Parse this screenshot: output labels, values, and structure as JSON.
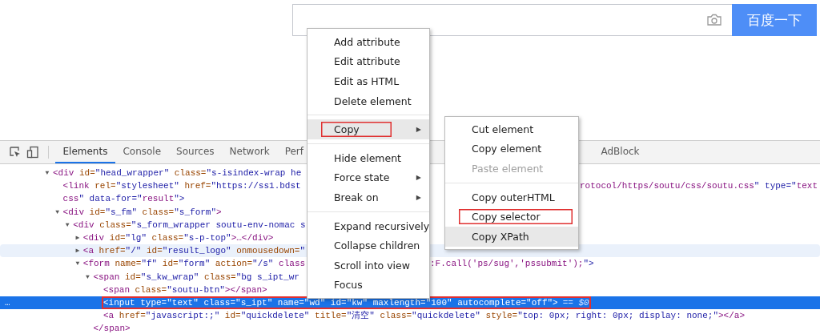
{
  "search": {
    "button": "百度一下"
  },
  "toolbar": {
    "tabs": [
      {
        "label": "Elements",
        "selected": true
      },
      {
        "label": "Console",
        "selected": false
      },
      {
        "label": "Sources",
        "selected": false
      },
      {
        "label": "Network",
        "selected": false
      },
      {
        "label": "Perf",
        "selected": false
      }
    ],
    "tabs_right": [
      {
        "label": "AdBlock",
        "selected": false
      }
    ]
  },
  "dom_tree": [
    {
      "toggle": "▼",
      "text": "<div id=\"head_wrapper\" class=\"s-isindex-wrap he",
      "selected": false,
      "hovered": false,
      "annotated": false,
      "children": [
        {
          "text": "<link rel=\"stylesheet\" href=\"https://ss1.bdst",
          "right_segment": {
            "kind": "beside_submenu",
            "text": "rotocol/https/soutu/css/soutu.css\" type=\"text"
          },
          "wrap_text": "css\" data-for=\"result\">",
          "selected": false,
          "hovered": false,
          "annotated": false
        },
        {
          "toggle": "▼",
          "text": "<div id=\"s_fm\" class=\"s_form\">",
          "selected": false,
          "hovered": false,
          "annotated": false,
          "children": [
            {
              "toggle": "▼",
              "text": "<div class=\"s_form_wrapper soutu-env-nomac s",
              "selected": false,
              "hovered": false,
              "annotated": false,
              "children": [
                {
                  "toggle": "▶",
                  "text": "<div id=\"lg\" class=\"s-p-top\">…</div>",
                  "selected": false,
                  "hovered": false,
                  "annotated": false
                },
                {
                  "toggle": "▶",
                  "text": "<a href=\"/\" id=\"result_logo\" onmousedown=\"",
                  "selected": false,
                  "hovered": true,
                  "annotated": false
                },
                {
                  "toggle": "▼",
                  "text": "<form name=\"f\" id=\"form\" action=\"/s\" class",
                  "right_segment": {
                    "kind": "beside_menu",
                    "text": ":F.call('ps/sug','pssubmit');\">"
                  },
                  "selected": false,
                  "hovered": false,
                  "annotated": false,
                  "children": [
                    {
                      "toggle": "▼",
                      "text": "<span id=\"s_kw_wrap\" class=\"bg s_ipt_wr",
                      "selected": false,
                      "hovered": false,
                      "annotated": false,
                      "closing": "</span>",
                      "children": [
                        {
                          "text": "<span class=\"soutu-btn\"></span>",
                          "selected": false,
                          "hovered": false,
                          "annotated": false
                        },
                        {
                          "gutter": "…",
                          "text": "<input type=\"text\" class=\"s_ipt\" name=\"wd\" id=\"kw\" maxlength=\"100\" autocomplete=\"off\">",
                          "suffix": "== $0",
                          "selected": true,
                          "hovered": false,
                          "annotated": true
                        },
                        {
                          "text": "<a href=\"javascript:;\" id=\"quickdelete\" title=\"清空\" class=\"quickdelete\" style=\"top: 0px; right: 0px; display: none;\"></a>",
                          "selected": false,
                          "hovered": false,
                          "annotated": false
                        }
                      ]
                    }
                  ]
                }
              ]
            }
          ]
        }
      ]
    }
  ],
  "context_menu": {
    "items": [
      {
        "kind": "item",
        "label": "Add attribute",
        "highlighted": false,
        "annotated": false
      },
      {
        "kind": "item",
        "label": "Edit attribute",
        "highlighted": false,
        "annotated": false
      },
      {
        "kind": "item",
        "label": "Edit as HTML",
        "highlighted": false,
        "annotated": false
      },
      {
        "kind": "item",
        "label": "Delete element",
        "highlighted": false,
        "annotated": false
      },
      {
        "kind": "separator"
      },
      {
        "kind": "item",
        "label": "Copy",
        "highlighted": true,
        "annotated": true,
        "arrow": "▶"
      },
      {
        "kind": "separator"
      },
      {
        "kind": "item",
        "label": "Hide element",
        "highlighted": false,
        "annotated": false
      },
      {
        "kind": "item",
        "label": "Force state",
        "highlighted": false,
        "annotated": false,
        "arrow": "▶"
      },
      {
        "kind": "item",
        "label": "Break on",
        "highlighted": false,
        "annotated": false,
        "arrow": "▶"
      },
      {
        "kind": "separator"
      },
      {
        "kind": "item",
        "label": "Expand recursively",
        "highlighted": false,
        "annotated": false
      },
      {
        "kind": "item",
        "label": "Collapse children",
        "highlighted": false,
        "annotated": false
      },
      {
        "kind": "item",
        "label": "Scroll into view",
        "highlighted": false,
        "annotated": false
      },
      {
        "kind": "item",
        "label": "Focus",
        "highlighted": false,
        "annotated": false
      }
    ]
  },
  "copy_submenu": {
    "items": [
      {
        "kind": "item",
        "label": "Cut element",
        "highlighted": false,
        "annotated": false,
        "disabled": false
      },
      {
        "kind": "item",
        "label": "Copy element",
        "highlighted": false,
        "annotated": false,
        "disabled": false
      },
      {
        "kind": "item",
        "label": "Paste element",
        "highlighted": false,
        "annotated": false,
        "disabled": true
      },
      {
        "kind": "separator"
      },
      {
        "kind": "item",
        "label": "Copy outerHTML",
        "highlighted": false,
        "annotated": false,
        "disabled": false
      },
      {
        "kind": "item",
        "label": "Copy selector",
        "highlighted": false,
        "annotated": true,
        "disabled": false
      },
      {
        "kind": "item",
        "label": "Copy XPath",
        "highlighted": true,
        "annotated": false,
        "disabled": false
      }
    ]
  }
}
